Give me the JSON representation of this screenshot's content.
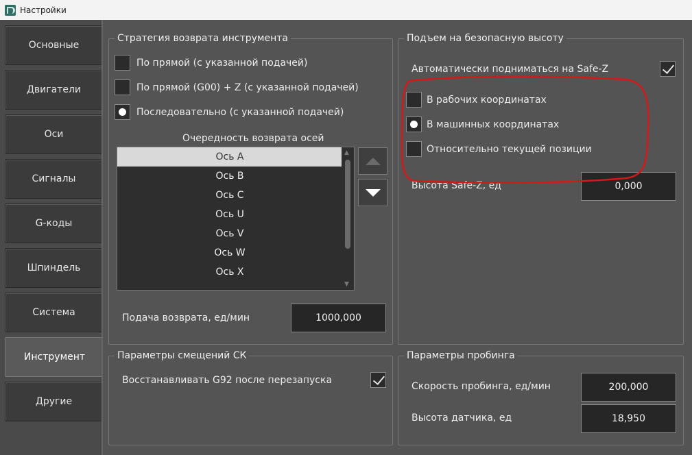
{
  "window": {
    "title": "Настройки"
  },
  "tabs": [
    {
      "label": "Основные",
      "active": false
    },
    {
      "label": "Двигатели",
      "active": false
    },
    {
      "label": "Оси",
      "active": false
    },
    {
      "label": "Сигналы",
      "active": false
    },
    {
      "label": "G-коды",
      "active": false
    },
    {
      "label": "Шпиндель",
      "active": false
    },
    {
      "label": "Система",
      "active": false
    },
    {
      "label": "Инструмент",
      "active": true
    },
    {
      "label": "Другие",
      "active": false
    }
  ],
  "return_strategy": {
    "title": "Стратегия возврата инструмента",
    "options": [
      {
        "label": "По прямой (с указанной подачей)",
        "selected": false
      },
      {
        "label": "По прямой (G00) + Z (с указанной подачей)",
        "selected": false
      },
      {
        "label": "Последовательно (с указанной подачей)",
        "selected": true
      }
    ],
    "axis_order_label": "Очередность возврата осей",
    "axes": [
      "Ось A",
      "Ось B",
      "Ось C",
      "Ось U",
      "Ось V",
      "Ось W",
      "Ось X"
    ],
    "selected_axis": "Ось A",
    "feed_label": "Подача возврата, ед/мин",
    "feed_value": "1000,000"
  },
  "safe_height": {
    "title": "Подъем на безопасную высоту",
    "auto_label": "Автоматически подниматься на Safe-Z",
    "auto_checked": true,
    "options": [
      {
        "label": "В рабочих координатах",
        "selected": false
      },
      {
        "label": "В машинных координатах",
        "selected": true
      },
      {
        "label": "Относительно текущей позиции",
        "selected": false
      }
    ],
    "height_label": "Высота Safe-Z, ед",
    "height_value": "0,000"
  },
  "offsets": {
    "title": "Параметры смещений СК",
    "restore_label": "Восстанавливать G92 после перезапуска",
    "restore_checked": true
  },
  "probing": {
    "title": "Параметры пробинга",
    "speed_label": "Скорость пробинга, ед/мин",
    "speed_value": "200,000",
    "sensor_label": "Высота датчика, ед",
    "sensor_value": "18,950"
  },
  "colors": {
    "annotation": "#d21a1a",
    "list_selected": "#d9d9d9"
  }
}
